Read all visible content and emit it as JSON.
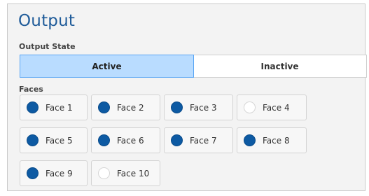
{
  "title": "Output",
  "output_state": {
    "label": "Output State",
    "options": [
      "Active",
      "Inactive"
    ],
    "selected": "Active"
  },
  "faces": {
    "label": "Faces",
    "items": [
      {
        "label": "Face 1",
        "checked": true
      },
      {
        "label": "Face 2",
        "checked": true
      },
      {
        "label": "Face 3",
        "checked": true
      },
      {
        "label": "Face 4",
        "checked": false
      },
      {
        "label": "Face 5",
        "checked": true
      },
      {
        "label": "Face 6",
        "checked": true
      },
      {
        "label": "Face 7",
        "checked": true
      },
      {
        "label": "Face 8",
        "checked": true
      },
      {
        "label": "Face 9",
        "checked": true
      },
      {
        "label": "Face 10",
        "checked": false
      }
    ]
  },
  "colors": {
    "title": "#1f5b99",
    "radio_on": "#0d5aa3",
    "active_bg": "#b9dcff",
    "active_border": "#5aa6f4"
  }
}
